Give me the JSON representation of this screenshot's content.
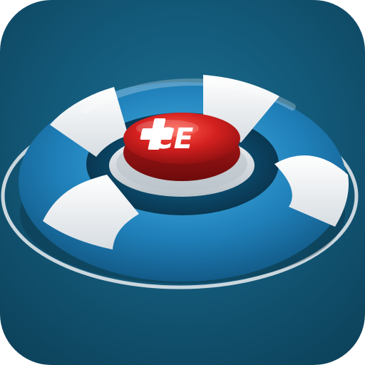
{
  "app_icon": {
    "button_label": "CE",
    "colors": {
      "background": "#135a7a",
      "ring_blue": "#1f7fb8",
      "ring_white": "#ffffff",
      "button_red": "#c81e1e"
    },
    "icons": {
      "ring": "lifebuoy-icon",
      "button": "emergency-button-icon",
      "plus": "medical-plus-icon"
    }
  }
}
